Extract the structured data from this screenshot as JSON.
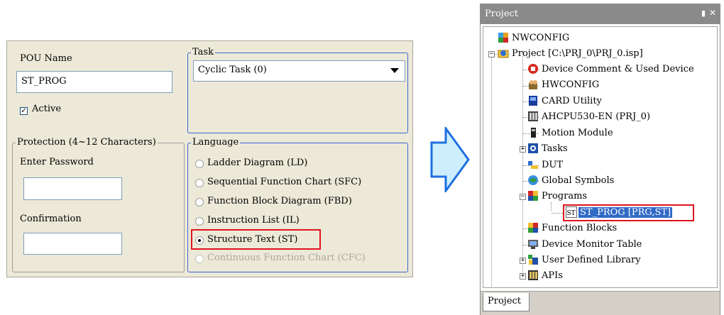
{
  "dialog": {
    "pou_name_label": "POU Name",
    "pou_name_value": "ST_PROG",
    "active_label": "Active",
    "active_checked": true,
    "task_group_label": "Task",
    "task_value": "Cyclic Task (0)",
    "protection_group_label": "Protection (4~12 Characters)",
    "enter_password_label": "Enter Password",
    "enter_password_value": "",
    "confirmation_label": "Confirmation",
    "confirmation_value": "",
    "language_group_label": "Language",
    "languages": [
      {
        "label": "Ladder Diagram (LD)",
        "selected": false,
        "enabled": true
      },
      {
        "label": "Sequential Function Chart (SFC)",
        "selected": false,
        "enabled": true
      },
      {
        "label": "Function Block Diagram (FBD)",
        "selected": false,
        "enabled": true
      },
      {
        "label": "Instruction List (IL)",
        "selected": false,
        "enabled": true
      },
      {
        "label": "Structure Text (ST)",
        "selected": true,
        "enabled": true
      },
      {
        "label": "Continuous Function Chart (CFC)",
        "selected": false,
        "enabled": false
      }
    ]
  },
  "project_panel": {
    "title": "Project",
    "pin_icon": "pin-icon",
    "close_icon": "close-icon",
    "tree": [
      {
        "label": "NWCONFIG",
        "icon": "nwconfig-icon"
      },
      {
        "label": "Project [C:\\PRJ_0\\PRJ_0.isp]",
        "icon": "project-icon",
        "expanded": true
      },
      {
        "label": "Device Comment & Used Device",
        "icon": "device-comment-icon"
      },
      {
        "label": "HWCONFIG",
        "icon": "hwconfig-icon"
      },
      {
        "label": "CARD Utility",
        "icon": "card-utility-icon"
      },
      {
        "label": "AHCPU530-EN  (PRJ_0)",
        "icon": "cpu-icon"
      },
      {
        "label": "Motion Module",
        "icon": "motion-module-icon"
      },
      {
        "label": "Tasks",
        "icon": "tasks-icon",
        "expanded": false
      },
      {
        "label": "DUT",
        "icon": "dut-icon"
      },
      {
        "label": "Global Symbols",
        "icon": "global-symbols-icon"
      },
      {
        "label": "Programs",
        "icon": "programs-icon",
        "expanded": true
      },
      {
        "label": "ST_PROG [PRG,ST]",
        "icon": "st-program-icon",
        "icon_text": "ST",
        "selected": true
      },
      {
        "label": "Function Blocks",
        "icon": "function-blocks-icon"
      },
      {
        "label": "Device Monitor Table",
        "icon": "device-monitor-icon"
      },
      {
        "label": "User Defined Library",
        "icon": "library-icon",
        "expanded": false
      },
      {
        "label": "APIs",
        "icon": "apis-icon",
        "expanded": false
      }
    ],
    "bottom_tab": "Project"
  },
  "colors": {
    "dialog_bg": "#ece9d8",
    "highlight_red": "#e0141e",
    "selection_blue": "#316ac5",
    "arrow_fill": "#cdeffd",
    "arrow_stroke": "#1e6fe0",
    "title_bar": "#8a8a8a"
  }
}
